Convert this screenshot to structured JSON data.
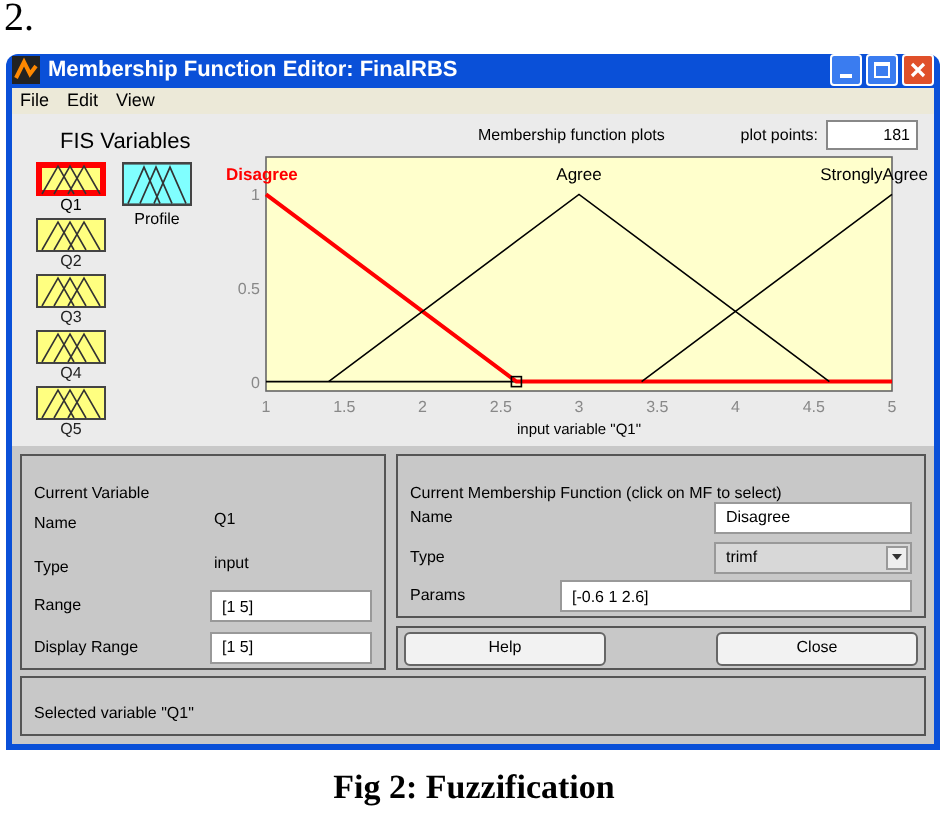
{
  "figure_number": "2.",
  "window": {
    "title": "Membership Function Editor: FinalRBS"
  },
  "menu": [
    "File",
    "Edit",
    "View"
  ],
  "fis_variables": {
    "heading": "FIS Variables",
    "inputs": [
      {
        "label": "Q1",
        "selected": true
      },
      {
        "label": "Q2",
        "selected": false
      },
      {
        "label": "Q3",
        "selected": false
      },
      {
        "label": "Q4",
        "selected": false
      },
      {
        "label": "Q5",
        "selected": false
      }
    ],
    "outputs": [
      {
        "label": "Profile",
        "selected": false
      }
    ]
  },
  "plot": {
    "heading": "Membership function plots",
    "plot_points_label": "plot points:",
    "plot_points": "181",
    "chart_data": {
      "type": "line",
      "xlabel": "input variable \"Q1\"",
      "x": [
        1,
        1.4,
        2.6,
        3,
        3.4,
        4.6,
        5
      ],
      "series": [
        {
          "name": "Disagree",
          "color": "#ff0000",
          "values": [
            1,
            0.75,
            0,
            0,
            0,
            0,
            0
          ]
        },
        {
          "name": "Agree",
          "color": "#000000",
          "values": [
            null,
            0,
            0.75,
            1,
            0.75,
            0,
            null
          ]
        },
        {
          "name": "StronglyAgree",
          "color": "#000000",
          "values": [
            null,
            null,
            null,
            null,
            0,
            0.75,
            1
          ]
        }
      ],
      "xlim": [
        1,
        5
      ],
      "ylim": [
        -0.05,
        1.2
      ],
      "xticks": [
        1,
        1.5,
        2,
        2.5,
        3,
        3.5,
        4,
        4.5,
        5
      ],
      "yticks": [
        0,
        0.5,
        1
      ]
    }
  },
  "current_variable": {
    "heading": "Current Variable",
    "name_label": "Name",
    "name": "Q1",
    "type_label": "Type",
    "type": "input",
    "range_label": "Range",
    "range": "[1 5]",
    "display_range_label": "Display Range",
    "display_range": "[1 5]"
  },
  "current_mf": {
    "heading": "Current Membership Function (click on MF to select)",
    "name_label": "Name",
    "name": "Disagree",
    "type_label": "Type",
    "type": "trimf",
    "params_label": "Params",
    "params": "[-0.6 1 2.6]"
  },
  "buttons": [
    "Help",
    "Close"
  ],
  "status": "Selected variable \"Q1\"",
  "caption": "Fig 2: Fuzzification"
}
